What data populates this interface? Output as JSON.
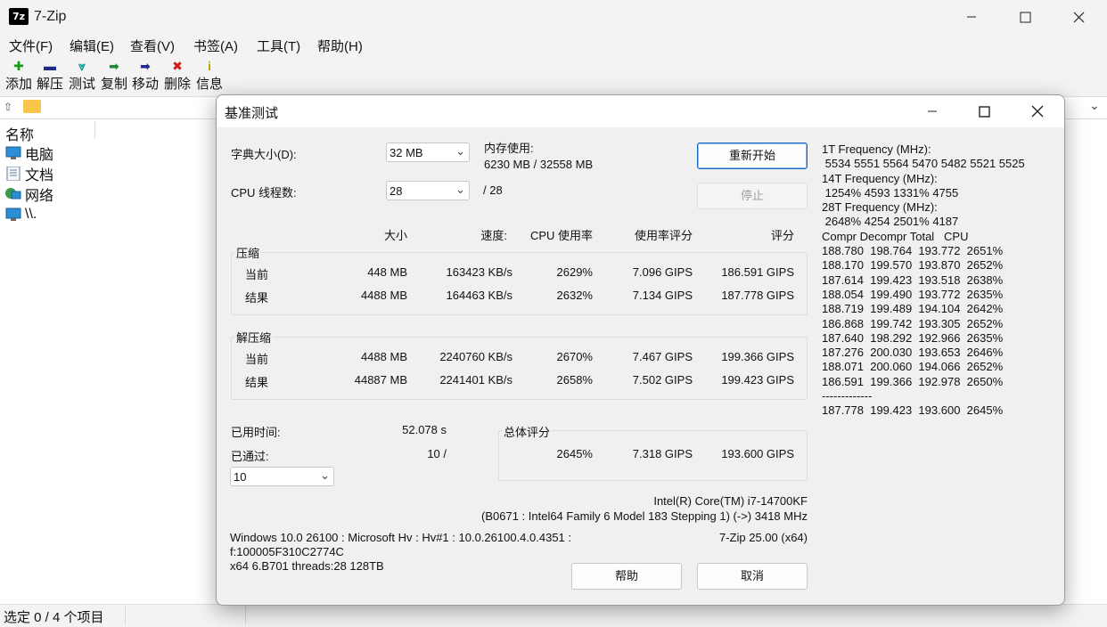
{
  "window": {
    "title": "7-Zip",
    "app_icon": "7z",
    "minimize_icon": "minimize-icon",
    "maximize_icon": "maximize-icon",
    "close_icon": "close-icon"
  },
  "menu": [
    "文件(F)",
    "编辑(E)",
    "查看(V)",
    "书签(A)",
    "工具(T)",
    "帮助(H)"
  ],
  "toolbar": {
    "items": [
      {
        "label": "添加",
        "icon": "plus-icon",
        "glyph": "✚",
        "color": "#1a9c1a"
      },
      {
        "label": "解压",
        "icon": "minus-icon",
        "glyph": "▬",
        "color": "#1f2a8c"
      },
      {
        "label": "测试",
        "icon": "check-down-icon",
        "glyph": "⩔",
        "color": "#1aa0a0"
      },
      {
        "label": "复制",
        "icon": "copy-arrow-icon",
        "glyph": "➡",
        "color": "#1a8a3a"
      },
      {
        "label": "移动",
        "icon": "move-arrow-icon",
        "glyph": "➡",
        "color": "#1f2a8c"
      },
      {
        "label": "删除",
        "icon": "delete-x-icon",
        "glyph": "✖",
        "color": "#d11a1a"
      },
      {
        "label": "信息",
        "icon": "info-icon",
        "glyph": "i",
        "color": "#b5a000"
      }
    ]
  },
  "file_list": {
    "column_name": "名称",
    "items": [
      {
        "label": "电脑",
        "icon": "computer-icon"
      },
      {
        "label": "文档",
        "icon": "document-icon"
      },
      {
        "label": "网络",
        "icon": "network-icon"
      },
      {
        "label": "\\\\.",
        "icon": "device-icon"
      }
    ]
  },
  "status_bar": {
    "text": "选定 0 / 4 个项目"
  },
  "dialog": {
    "title": "基准测试",
    "dict_label": "字典大小(D):",
    "dict_value": "32 MB",
    "threads_label": "CPU 线程数:",
    "threads_value": "28",
    "threads_max": "/ 28",
    "mem_label": "内存使用:",
    "mem_value": "6230 MB / 32558 MB",
    "restart_button": "重新开始",
    "stop_button": "停止",
    "headers": {
      "size": "大小",
      "speed": "速度:",
      "cpu": "CPU 使用率",
      "rating_per_usage": "使用率评分",
      "rating": "评分"
    },
    "compress": {
      "title": "压缩",
      "current": {
        "label": "当前",
        "size": "448 MB",
        "speed": "163423 KB/s",
        "cpu": "2629%",
        "rpu": "7.096 GIPS",
        "rating": "186.591 GIPS"
      },
      "result": {
        "label": "结果",
        "size": "4488 MB",
        "speed": "164463 KB/s",
        "cpu": "2632%",
        "rpu": "7.134 GIPS",
        "rating": "187.778 GIPS"
      }
    },
    "decompress": {
      "title": "解压缩",
      "current": {
        "label": "当前",
        "size": "4488 MB",
        "speed": "2240760 KB/s",
        "cpu": "2670%",
        "rpu": "7.467 GIPS",
        "rating": "199.366 GIPS"
      },
      "result": {
        "label": "结果",
        "size": "44887 MB",
        "speed": "2241401 KB/s",
        "cpu": "2658%",
        "rpu": "7.502 GIPS",
        "rating": "199.423 GIPS"
      }
    },
    "elapsed_label": "已用时间:",
    "elapsed_value": "52.078 s",
    "passes_label": "已通过:",
    "passes_value": "10 /",
    "passes_select": "10",
    "total": {
      "title": "总体评分",
      "cpu": "2645%",
      "rpu": "7.318 GIPS",
      "rating": "193.600 GIPS"
    },
    "cpu_name": "Intel(R) Core(TM) i7-14700KF",
    "cpu_detail": "(B0671 : Intel64 Family 6 Model 183 Stepping 1) (->) 3418 MHz",
    "os_line1": "Windows 10.0 26100 : Microsoft Hv : Hv#1 : 10.0.26100.4.0.4351 :",
    "os_line2": "f:100005F310C2774C",
    "os_line3": "x64 6.B701 threads:28 128TB",
    "version": "7-Zip 25.00 (x64)",
    "help_button": "帮助",
    "cancel_button": "取消",
    "freq_log": [
      "1T Frequency (MHz):",
      " 5534 5551 5564 5470 5482 5521 5525",
      "14T Frequency (MHz):",
      " 1254% 4593 1331% 4755",
      "28T Frequency (MHz):",
      " 2648% 4254 2501% 4187",
      "Compr Decompr Total   CPU",
      "188.780  198.764  193.772  2651%",
      "188.170  199.570  193.870  2652%",
      "187.614  199.423  193.518  2638%",
      "188.054  199.490  193.772  2635%",
      "188.719  199.489  194.104  2642%",
      "186.868  199.742  193.305  2652%",
      "187.640  198.292  192.966  2635%",
      "187.276  200.030  193.653  2646%",
      "188.071  200.060  194.066  2652%",
      "186.591  199.366  192.978  2650%",
      "-------------",
      "187.778  199.423  193.600  2645%"
    ]
  }
}
